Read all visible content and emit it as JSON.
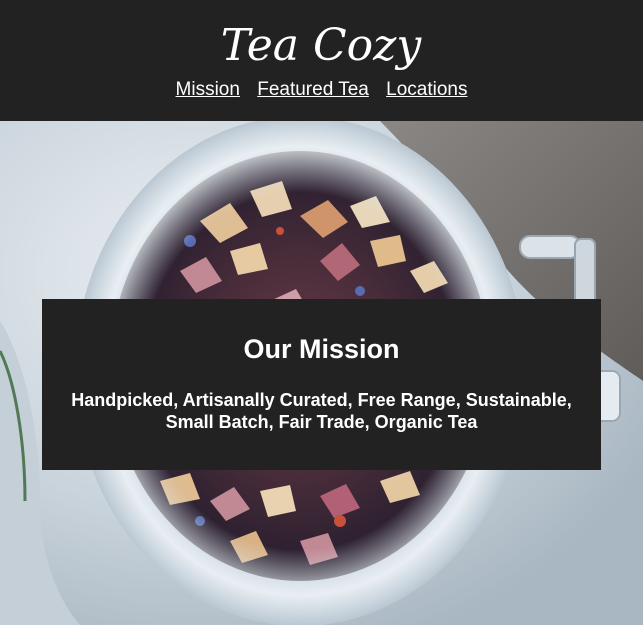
{
  "header": {
    "logo_text": "Tea Cozy",
    "nav": [
      {
        "label": "Mission"
      },
      {
        "label": "Featured Tea"
      },
      {
        "label": "Locations"
      }
    ]
  },
  "hero": {
    "image": "loose-leaf-tea-jar",
    "mission": {
      "title": "Our Mission",
      "line1": "Handpicked, Artisanally Curated, Free Range, Sustainable,",
      "line2": "Small Batch, Fair Trade, Organic Tea"
    }
  },
  "colors": {
    "header_bg": "#222222",
    "text": "#ffffff",
    "mission_bg": "#222222"
  }
}
